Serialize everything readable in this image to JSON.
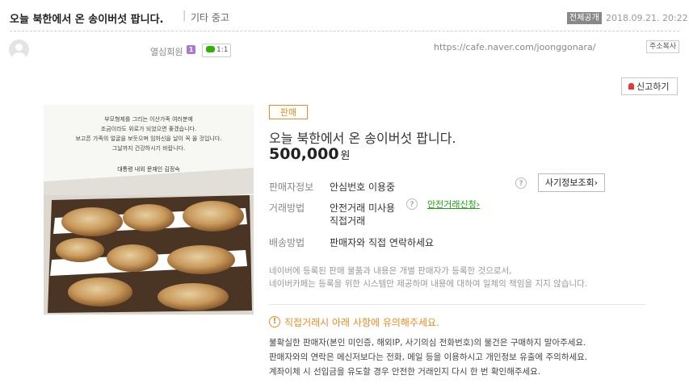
{
  "header": {
    "title": "오늘 북한에서 온 송이버섯 팝니다.",
    "separator": "|",
    "board": "기타 중고",
    "public_badge": "전체공개",
    "date": "2018.09.21. 20:22"
  },
  "author": {
    "grade": "열심회원",
    "grade_icon": "1",
    "chat_label": "1:1",
    "cafe_url": "https://cafe.naver.com/joonggonara/",
    "copy_url_label": "주소복사"
  },
  "report_label": "신고하기",
  "product": {
    "sale_badge": "판매",
    "title": "오늘 북한에서 온 송이버섯 팝니다.",
    "price": "500,000",
    "price_unit": "원",
    "seller_info_label": "판매자정보",
    "seller_info_value": "안심번호 이용중",
    "fraud_check_label": "사기정보조회",
    "trade_method_label": "거래방법",
    "trade_method_value1": "안전거래 미사용",
    "trade_method_value2": "직접거래",
    "safe_trade_link": "안전거래신청",
    "shipping_label": "배송방법",
    "shipping_value": "판매자와 직접 연락하세요",
    "disclaimer_line1": "네이버에 등록된 판매 물품과 내용은 개별 판매자가 등록한 것으로서,",
    "disclaimer_line2": "네이버카페는 등록을 위한 시스템만 제공하며 내용에 대하여 일체의 책임을 지지 않습니다."
  },
  "warning": {
    "icon": "!",
    "title": "직접거래시 아래 사항에 유의해주세요.",
    "line1": "불확실한 판매자(본인 미인증, 해외IP, 사기의심 전화번호)의 물건은 구매하지 말아주세요.",
    "line2": "판매자와의 연락은 메신저보다는 전화, 메일 등을 이용하시고 개인정보 유출에 주의하세요.",
    "line3": "계좌이체 시 선입금을 유도할 경우 안전한 거래인지 다시 한 번 확인해주세요."
  },
  "image": {
    "card_line1": "부모형제를 그리는 이산가족 여러분께",
    "card_line2": "조금이라도 위로가 되었으면 좋겠습니다.",
    "card_line3": "보고픈 가족의 얼굴을 보듯으며 임하신을 날이 꼭 올 것입니다.",
    "card_line4": "그날까지 건강하시기 바랍니다.",
    "card_sign": "대통령 내외 문재인 김정숙"
  },
  "icons": {
    "question": "?",
    "chevron": "›"
  },
  "colors": {
    "accent": "#f08a24",
    "link_green": "#1ea415",
    "badge_gray": "#888888",
    "grade_purple": "#a779d6"
  }
}
